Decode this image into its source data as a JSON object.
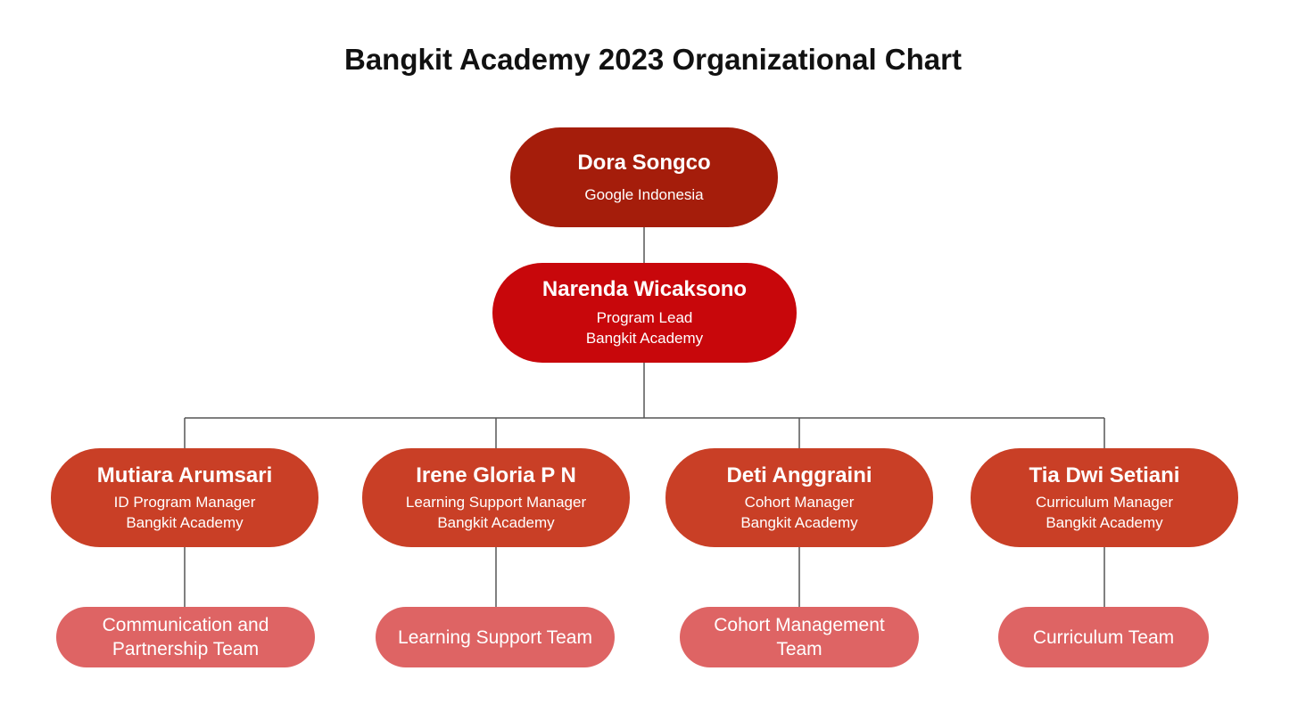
{
  "title": "Bangkit Academy 2023 Organizational Chart",
  "root": {
    "name": "Dora Songco",
    "org": "Google Indonesia"
  },
  "lead": {
    "name": "Narenda Wicaksono",
    "role": "Program Lead",
    "org": "Bangkit Academy"
  },
  "managers": [
    {
      "name": "Mutiara Arumsari",
      "role": "ID Program Manager",
      "org": "Bangkit Academy",
      "team": "Communication and Partnership Team"
    },
    {
      "name": "Irene Gloria P N",
      "role": "Learning Support Manager",
      "org": "Bangkit Academy",
      "team": "Learning Support Team"
    },
    {
      "name": "Deti Anggraini",
      "role": "Cohort Manager",
      "org": "Bangkit Academy",
      "team": "Cohort Management Team"
    },
    {
      "name": "Tia Dwi Setiani",
      "role": "Curriculum Manager",
      "org": "Bangkit Academy",
      "team": "Curriculum Team"
    }
  ],
  "colors": {
    "root": "#a51d0b",
    "lead": "#c8070b",
    "manager": "#c93f26",
    "team": "#de6464",
    "connector": "#555555"
  }
}
